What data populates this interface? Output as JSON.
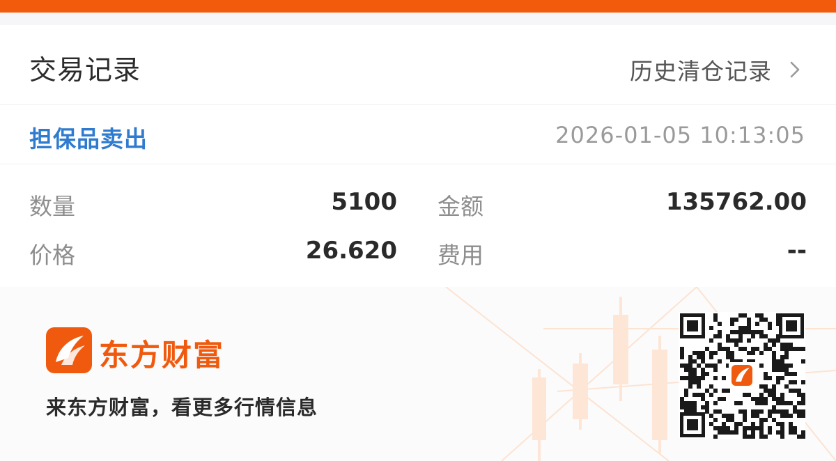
{
  "header": {
    "title": "交易记录",
    "history_link": "历史清仓记录",
    "chevron_icon": "chevron-right-icon"
  },
  "record": {
    "type": "担保品卖出",
    "datetime": "2026-01-05 10:13:05",
    "quantity_label": "数量",
    "quantity_value": "5100",
    "amount_label": "金额",
    "amount_value": "135762.00",
    "price_label": "价格",
    "price_value": "26.620",
    "fee_label": "费用",
    "fee_value": "--"
  },
  "promo": {
    "brand_name": "东方财富",
    "slogan": "来东方财富，看更多行情信息",
    "logo_icon": "eastmoney-logo-icon",
    "qr_icon": "qr-code-icon"
  },
  "colors": {
    "accent": "#f25a0c",
    "link_blue": "#2f7bcf",
    "text_dark": "#2b2b2b",
    "text_muted": "#8d8d8d"
  }
}
